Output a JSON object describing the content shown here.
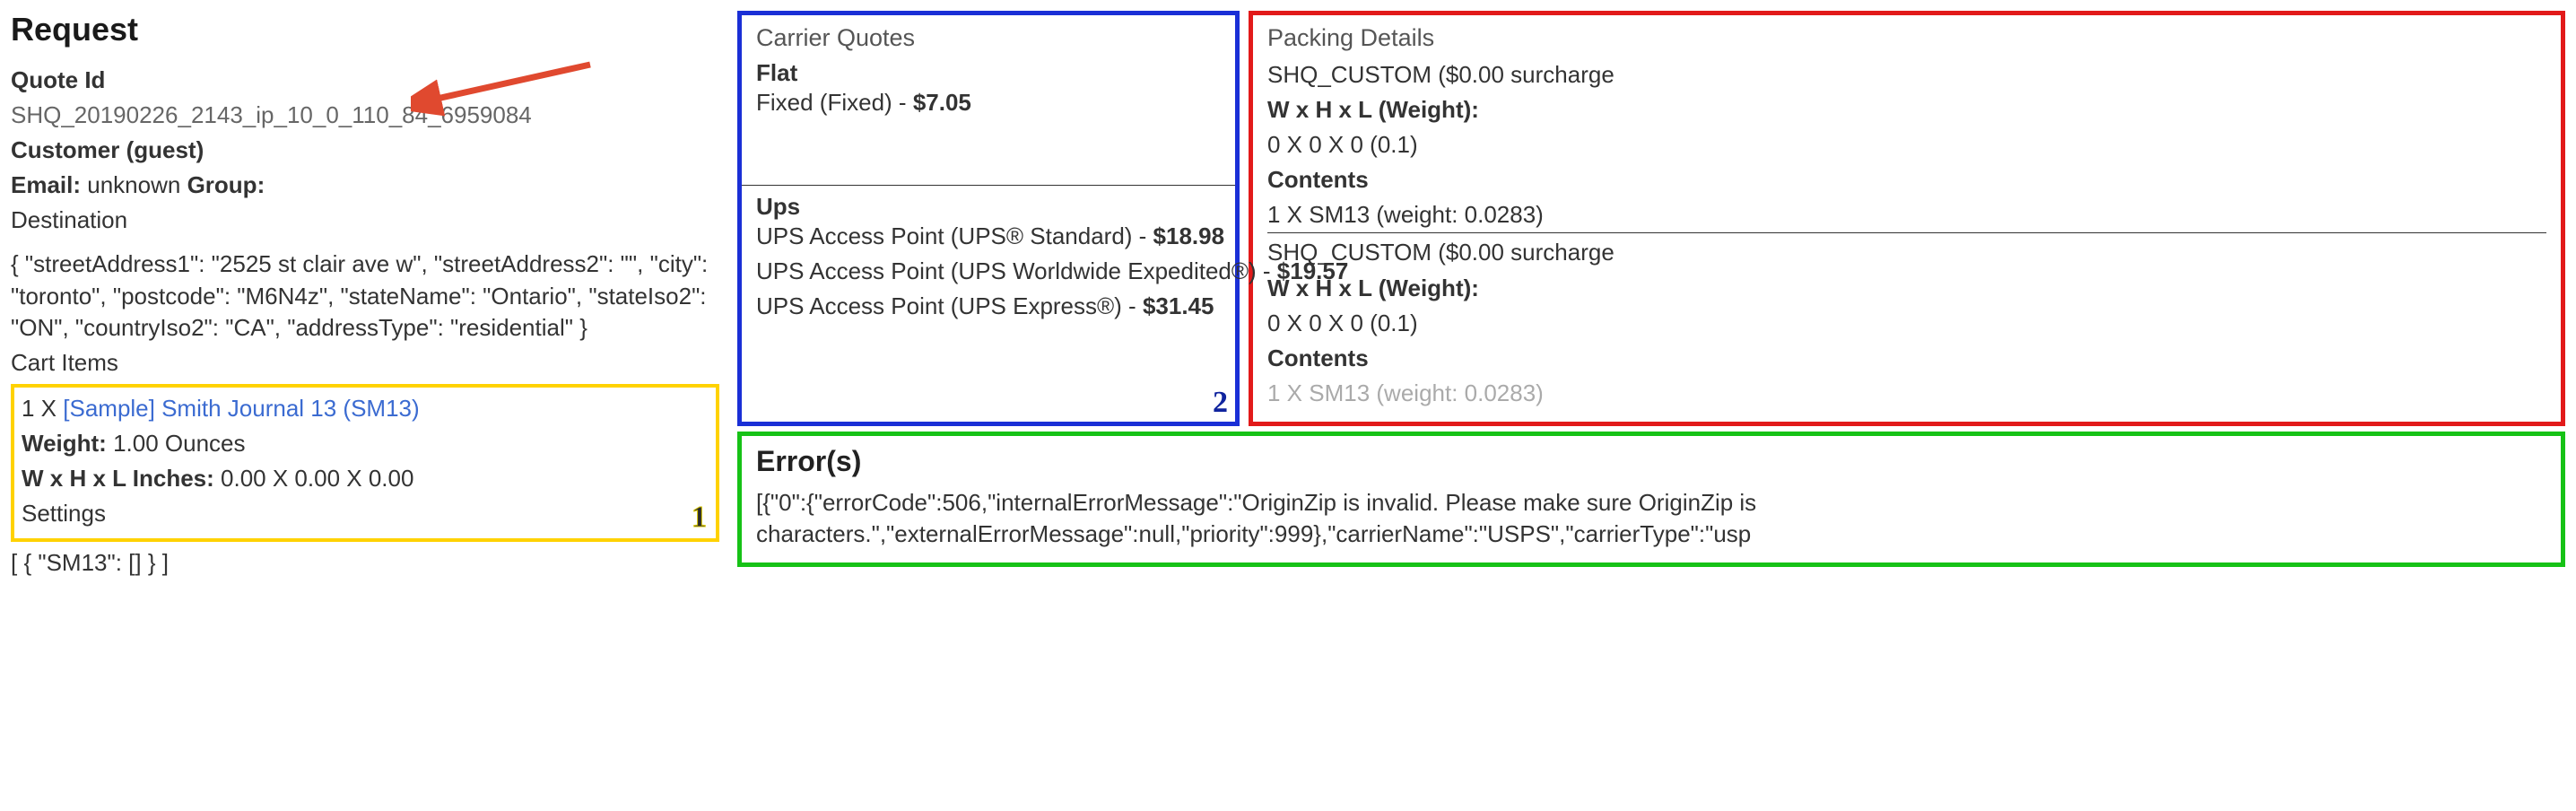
{
  "request": {
    "title": "Request",
    "quoteIdLabel": "Quote Id",
    "quoteId": "SHQ_20190226_2143_ip_10_0_110_84_6959084",
    "customerLabel": "Customer (guest)",
    "emailLabel": "Email:",
    "emailValue": "unknown",
    "groupLabel": "Group:",
    "destinationLabel": "Destination",
    "destinationJson": "{ \"streetAddress1\": \"2525 st clair ave w\", \"streetAddress2\": \"\", \"city\": \"toronto\", \"postcode\": \"M6N4z\", \"stateName\": \"Ontario\", \"stateIso2\": \"ON\", \"countryIso2\": \"CA\", \"addressType\": \"residential\" }",
    "cartItemsLabel": "Cart Items",
    "cart": {
      "qtyPrefix": "1 X",
      "itemName": "[Sample] Smith Journal 13 (SM13)",
      "weightLabel": "Weight:",
      "weightValue": "1.00 Ounces",
      "dimsLabel": "W x H x L Inches:",
      "dimsValue": "0.00 X 0.00 X 0.00",
      "settingsLabel": "Settings"
    },
    "settingsJson": "[ { \"SM13\": [] } ]"
  },
  "carrierQuotes": {
    "title": "Carrier Quotes",
    "flat": {
      "name": "Flat",
      "line1a": "Fixed (Fixed) - ",
      "line1b": "$7.05"
    },
    "ups": {
      "name": "Ups",
      "line1a": "UPS Access Point (UPS® Standard) - ",
      "line1b": "$18.98",
      "line2a": "UPS Access Point (UPS Worldwide Expedited®) - ",
      "line2b": "$19.57",
      "line3a": "UPS Access Point (UPS Express®) - ",
      "line3b": "$31.45"
    }
  },
  "packing": {
    "title": "Packing Details",
    "group1": {
      "name": "SHQ_CUSTOM ($0.00 surcharge",
      "dimsLabel": "W x H x L (Weight):",
      "dimsValue": "0 X 0 X 0 (0.1)",
      "contentsLabel": "Contents",
      "contentsValue": "1 X SM13 (weight: 0.0283)"
    },
    "group2": {
      "name": "SHQ_CUSTOM ($0.00 surcharge",
      "dimsLabel": "W x H x L (Weight):",
      "dimsValue": "0 X 0 X 0 (0.1)",
      "contentsLabel": "Contents",
      "contentsValue": "1 X SM13 (weight: 0.0283)"
    }
  },
  "errors": {
    "title": "Error(s)",
    "body": "[{\"0\":{\"errorCode\":506,\"internalErrorMessage\":\"OriginZip is invalid. Please make sure OriginZip is characters.\",\"externalErrorMessage\":null,\"priority\":999},\"carrierName\":\"USPS\",\"carrierType\":\"usp"
  },
  "badges": {
    "one": "1",
    "two": "2"
  }
}
